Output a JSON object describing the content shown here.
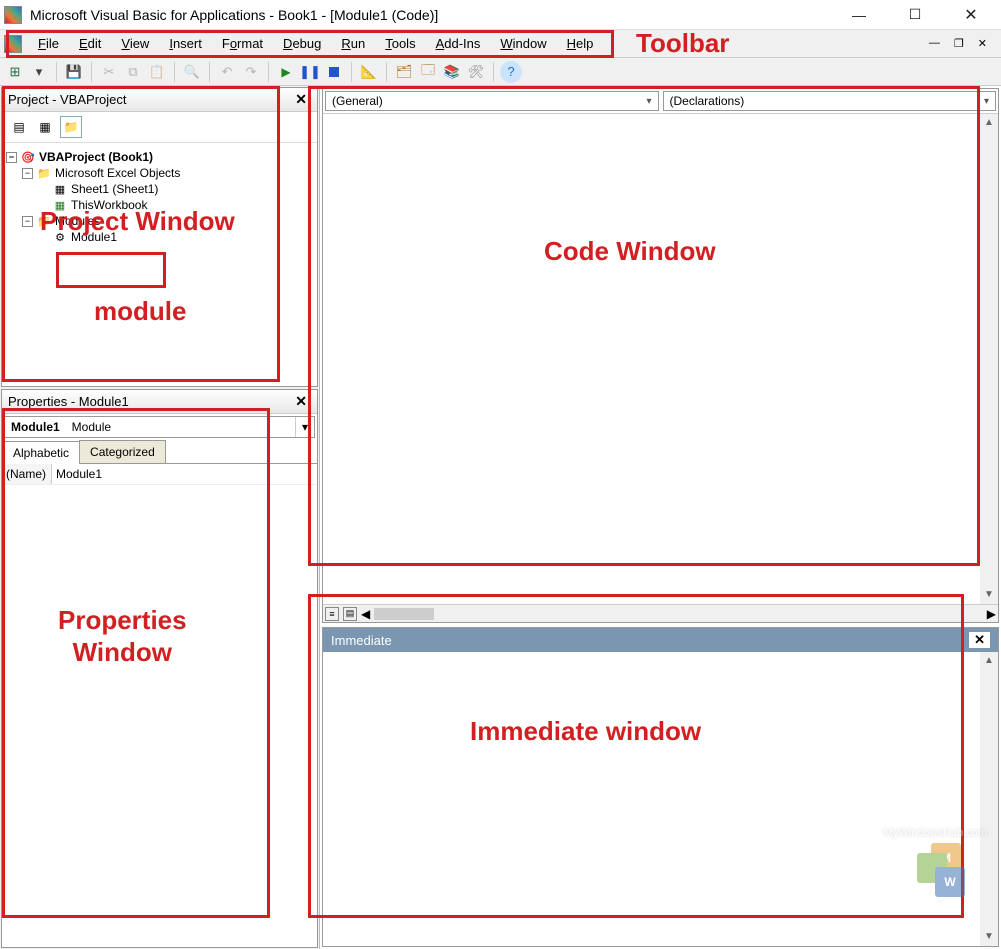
{
  "title": "Microsoft Visual Basic for Applications - Book1 - [Module1 (Code)]",
  "menus": [
    "File",
    "Edit",
    "View",
    "Insert",
    "Format",
    "Debug",
    "Run",
    "Tools",
    "Add-Ins",
    "Window",
    "Help"
  ],
  "project": {
    "title": "Project - VBAProject",
    "root": "VBAProject (Book1)",
    "excel_objects": "Microsoft Excel Objects",
    "sheet1": "Sheet1 (Sheet1)",
    "workbook": "ThisWorkbook",
    "modules_folder": "Modules",
    "module1": "Module1"
  },
  "properties": {
    "title": "Properties - Module1",
    "object_name": "Module1",
    "object_type": "Module",
    "tab_alpha": "Alphabetic",
    "tab_cat": "Categorized",
    "prop_name_label": "(Name)",
    "prop_name_value": "Module1"
  },
  "code": {
    "left_dropdown": "(General)",
    "right_dropdown": "(Declarations)",
    "content": ""
  },
  "immediate": {
    "title": "Immediate",
    "content": ""
  },
  "annotations": {
    "toolbar": "Toolbar",
    "project_window": "Project Window",
    "module": "module",
    "properties_window": "Properties Window",
    "code_window": "Code Window",
    "immediate_window": "Immediate window"
  },
  "watermark": "MyWindowsHub.com",
  "watermark_letter_m": "M",
  "watermark_letter_w": "W"
}
